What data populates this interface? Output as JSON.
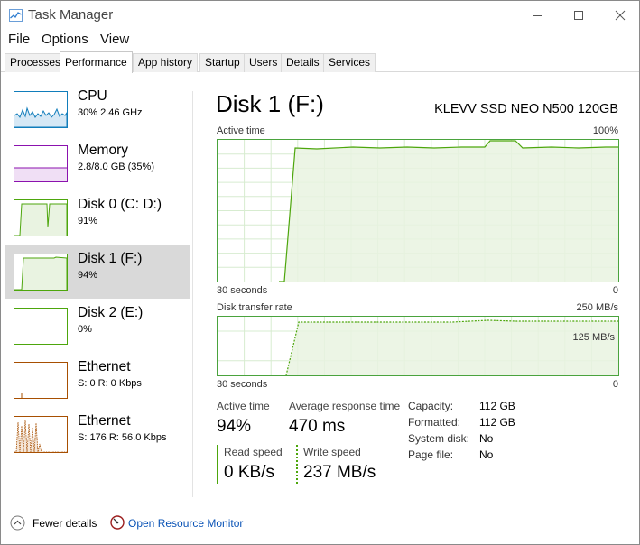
{
  "window": {
    "title": "Task Manager"
  },
  "menu": [
    "File",
    "Options",
    "View"
  ],
  "tabs": [
    {
      "label": "Processes",
      "active": false
    },
    {
      "label": "Performance",
      "active": true
    },
    {
      "label": "App history",
      "active": false
    },
    {
      "label": "Startup",
      "active": false
    },
    {
      "label": "Users",
      "active": false
    },
    {
      "label": "Details",
      "active": false
    },
    {
      "label": "Services",
      "active": false
    }
  ],
  "sidebar": {
    "items": [
      {
        "name": "CPU",
        "value": "30%  2.46 GHz",
        "color": "#117dbb"
      },
      {
        "name": "Memory",
        "value": "2.8/8.0 GB (35%)",
        "color": "#8b12ae"
      },
      {
        "name": "Disk 0 (C: D:)",
        "value": "91%",
        "color": "#4da60c"
      },
      {
        "name": "Disk 1 (F:)",
        "value": "94%",
        "color": "#4da60c",
        "selected": true
      },
      {
        "name": "Disk 2 (E:)",
        "value": "0%",
        "color": "#4da60c"
      },
      {
        "name": "Ethernet",
        "value": "S: 0  R: 0 Kbps",
        "color": "#a74f01"
      },
      {
        "name": "Ethernet",
        "value": "S: 176  R: 56.0 Kbps",
        "color": "#a74f01"
      }
    ]
  },
  "main": {
    "title": "Disk 1 (F:)",
    "device": "KLEVV SSD NEO N500 120GB",
    "active_graph": {
      "label": "Active time",
      "max": "100%",
      "time": "30 seconds",
      "min": "0"
    },
    "transfer_graph": {
      "label": "Disk transfer rate",
      "max": "250 MB/s",
      "mid": "125 MB/s",
      "time": "30 seconds",
      "min": "0"
    },
    "stats": {
      "active_time_label": "Active time",
      "active_time": "94%",
      "response_label": "Average response time",
      "response": "470 ms",
      "read_label": "Read speed",
      "read": "0 KB/s",
      "write_label": "Write speed",
      "write": "237 MB/s"
    },
    "props": [
      {
        "label": "Capacity:",
        "value": "112 GB"
      },
      {
        "label": "Formatted:",
        "value": "112 GB"
      },
      {
        "label": "System disk:",
        "value": "No"
      },
      {
        "label": "Page file:",
        "value": "No"
      }
    ]
  },
  "footer": {
    "fewer": "Fewer details",
    "monitor": "Open Resource Monitor"
  },
  "colors": {
    "disk": "#4da60c",
    "disk_fill": "#e9f3e1",
    "link": "#0a53b6"
  }
}
